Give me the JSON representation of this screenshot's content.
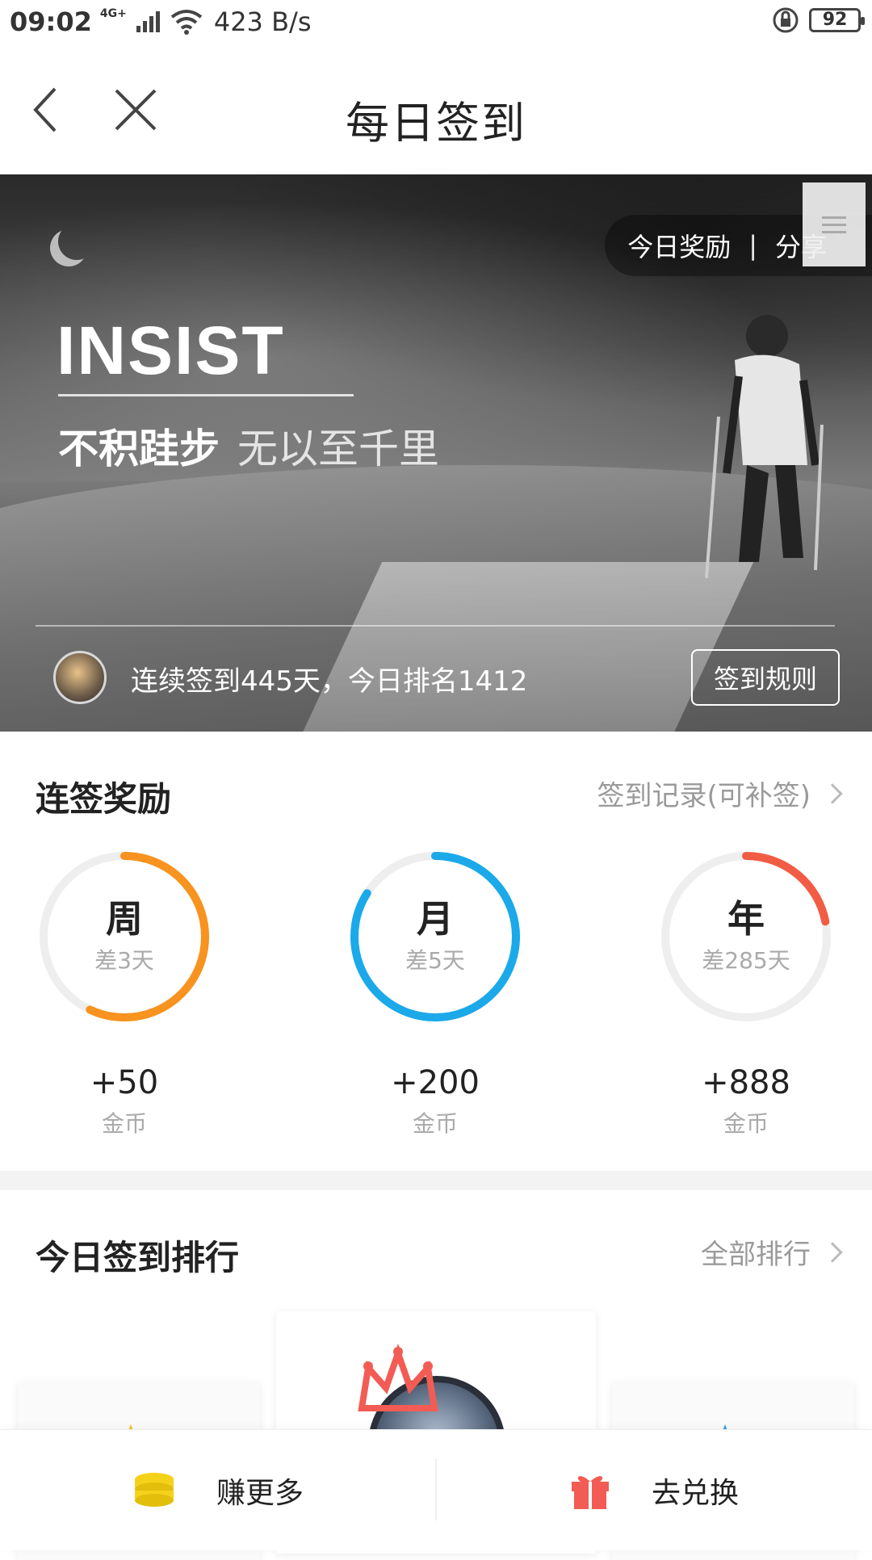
{
  "status_bar": {
    "time": "09:02",
    "network": "4G+",
    "speed": "423 B/s",
    "battery": "92"
  },
  "header": {
    "title": "每日签到"
  },
  "banner": {
    "actions": {
      "reward": "今日奖励",
      "separator": "|",
      "share": "分享"
    },
    "headline": "INSIST",
    "motto_a": "不积跬步",
    "motto_b": "无以至千里",
    "streak_text": "连续签到445天，今日排名1412",
    "rules_button": "签到规则"
  },
  "rewards": {
    "title": "连签奖励",
    "link": "签到记录(可补签)",
    "items": [
      {
        "label": "周",
        "remaining": "差3天",
        "amount": "+50",
        "unit": "金币",
        "color": "#f7931e",
        "progress": 0.57
      },
      {
        "label": "月",
        "remaining": "差5天",
        "amount": "+200",
        "unit": "金币",
        "color": "#1ba9ea",
        "progress": 0.84
      },
      {
        "label": "年",
        "remaining": "差285天",
        "amount": "+888",
        "unit": "金币",
        "color": "#f25c44",
        "progress": 0.22
      }
    ]
  },
  "ranking": {
    "title": "今日签到排行",
    "link": "全部排行"
  },
  "bottom_bar": {
    "earn_more": "赚更多",
    "redeem": "去兑换",
    "earn_icon_color": "#f5d21a",
    "redeem_icon_color": "#f25c54"
  }
}
